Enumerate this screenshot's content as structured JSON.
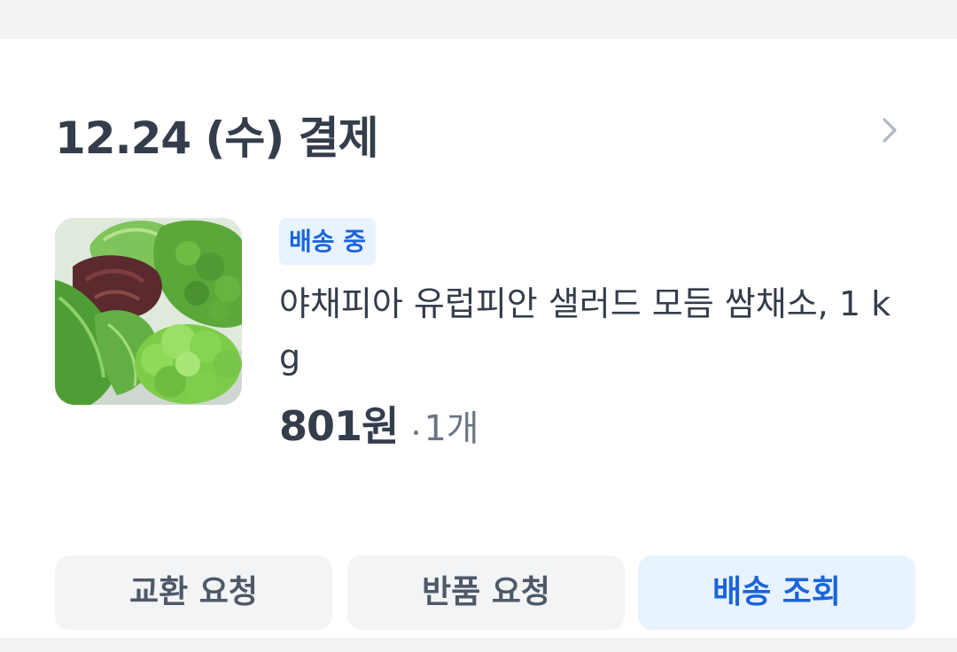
{
  "order": {
    "title": "12.24 (수) 결제",
    "chevron_icon": "chevron-right-icon"
  },
  "product": {
    "image_icon": "salad-greens-photo",
    "status": "배송 중",
    "name": "야채피아 유럽피안 샐러드 모듬 쌈채소, 1 kg",
    "price": "801원",
    "quantity": "1개"
  },
  "actions": {
    "exchange_label": "교환 요청",
    "return_label": "반품 요청",
    "tracking_label": "배송 조회"
  },
  "colors": {
    "accent_blue": "#1b64da",
    "badge_bg": "#e8f3ff",
    "button_gray_bg": "#f2f4f6",
    "text_dark": "#333d4b",
    "text_sub": "#6b7684"
  }
}
